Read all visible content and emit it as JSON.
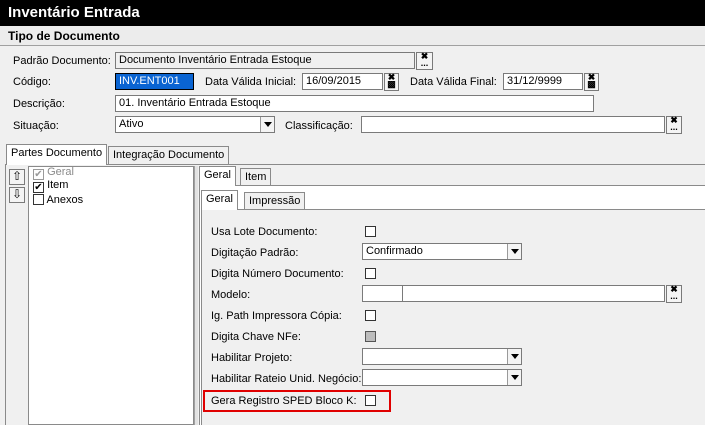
{
  "window": {
    "title": "Inventário Entrada"
  },
  "section": {
    "title": "Tipo de Documento"
  },
  "form": {
    "padrao_label": "Padrão Documento:",
    "padrao_value": "Documento Inventário Entrada Estoque",
    "codigo_label": "Código:",
    "codigo_value": "INV.ENT001",
    "data_inicial_label": "Data Válida Inicial:",
    "data_inicial_value": "16/09/2015",
    "data_final_label": "Data Válida Final:",
    "data_final_value": "31/12/9999",
    "descricao_label": "Descrição:",
    "descricao_value": "01. Inventário Entrada Estoque",
    "situacao_label": "Situação:",
    "situacao_value": "Ativo",
    "classificacao_label": "Classificação:",
    "classificacao_value": ""
  },
  "outer_tabs": [
    "Partes Documento",
    "Integração Documento"
  ],
  "tree": {
    "items": [
      {
        "label": "Geral",
        "checked": true,
        "disabled": true
      },
      {
        "label": "Item",
        "checked": true,
        "disabled": false
      },
      {
        "label": "Anexos",
        "checked": false,
        "disabled": false
      }
    ]
  },
  "inner_tabs": [
    "Geral",
    "Item"
  ],
  "sub_tabs": [
    "Geral",
    "Impressão"
  ],
  "geral": {
    "usa_lote_label": "Usa Lote Documento:",
    "digitacao_padrao_label": "Digitação Padrão:",
    "digitacao_padrao_value": "Confirmado",
    "digita_numero_label": "Digita Número Documento:",
    "modelo_label": "Modelo:",
    "modelo_code": "",
    "modelo_desc": "",
    "ig_path_label": "Ig. Path Impressora Cópia:",
    "digita_chave_label": "Digita Chave NFe:",
    "habilitar_projeto_label": "Habilitar Projeto:",
    "habilitar_projeto_value": "",
    "habilitar_rateio_label": "Habilitar Rateio Unid. Negócio:",
    "habilitar_rateio_value": "",
    "gera_sped_label": "Gera Registro SPED Bloco K:"
  },
  "icons": {
    "clear": "✖",
    "ellipsis": "...",
    "arrow_up": "⇧",
    "arrow_down": "⇩"
  },
  "colors": {
    "highlight": "#e00000",
    "selection": "#0a64d2"
  }
}
